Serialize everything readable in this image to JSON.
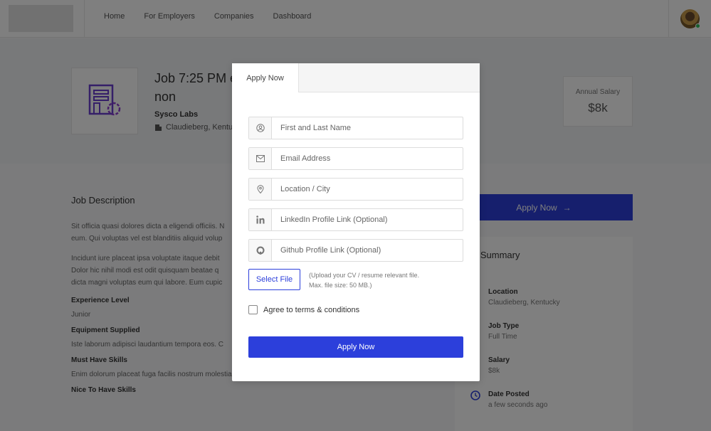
{
  "nav": {
    "links": [
      "Home",
      "For Employers",
      "Companies",
      "Dashboard"
    ]
  },
  "job": {
    "title": "Job 7:25 PM e non",
    "company": "Sysco Labs",
    "location": "Claudieberg, Kentu",
    "salary_label": "Annual Salary",
    "salary_value": "$8k"
  },
  "description": {
    "heading": "Job Description",
    "para1_line1": "Sit officia quasi dolores dicta a eligendi officiis. N",
    "para1_line2": "eum. Qui voluptas vel est blanditiis aliquid volup",
    "para2_line1": "Incidunt iure placeat ipsa voluptate itaque debit",
    "para2_line2": "Dolor hic nihil modi est odit quisquam beatae q",
    "para2_line3": "dicta magni voluptas eum qui labore. Eum cupic",
    "experience_label": "Experience Level",
    "experience_value": "Junior",
    "equipment_label": "Equipment Supplied",
    "equipment_value": "Iste laborum adipisci laudantium tempora eos. C",
    "must_label": "Must Have Skills",
    "must_value": "Enim dolorum placeat fuga facilis nostrum molestias delectus et voluptas. Sint autem ut odit omnis.",
    "nice_label": "Nice To Have Skills"
  },
  "sidebar": {
    "apply_label": "Apply Now",
    "summary_title": "b Summary",
    "items": [
      {
        "key": "Location",
        "value": "Claudieberg, Kentucky"
      },
      {
        "key": "Job Type",
        "value": "Full Time"
      },
      {
        "key": "Salary",
        "value": "$8k"
      },
      {
        "key": "Date Posted",
        "value": "a few seconds ago"
      }
    ]
  },
  "modal": {
    "tab_label": "Apply Now",
    "fields": [
      {
        "placeholder": "First and Last Name",
        "icon": "user-icon"
      },
      {
        "placeholder": "Email Address",
        "icon": "mail-icon"
      },
      {
        "placeholder": "Location / City",
        "icon": "location-pin-icon"
      },
      {
        "placeholder": "LinkedIn Profile Link (Optional)",
        "icon": "linkedin-icon"
      },
      {
        "placeholder": "Github Profile Link (Optional)",
        "icon": "github-icon"
      }
    ],
    "select_file_label": "Select File",
    "upload_note_line1": "(Upload your CV / resume relevant file.",
    "upload_note_line2": "Max. file size: 50 MB.)",
    "terms_label": "Agree to terms & conditions",
    "submit_label": "Apply Now"
  },
  "colors": {
    "accent": "#2c3fdb"
  }
}
